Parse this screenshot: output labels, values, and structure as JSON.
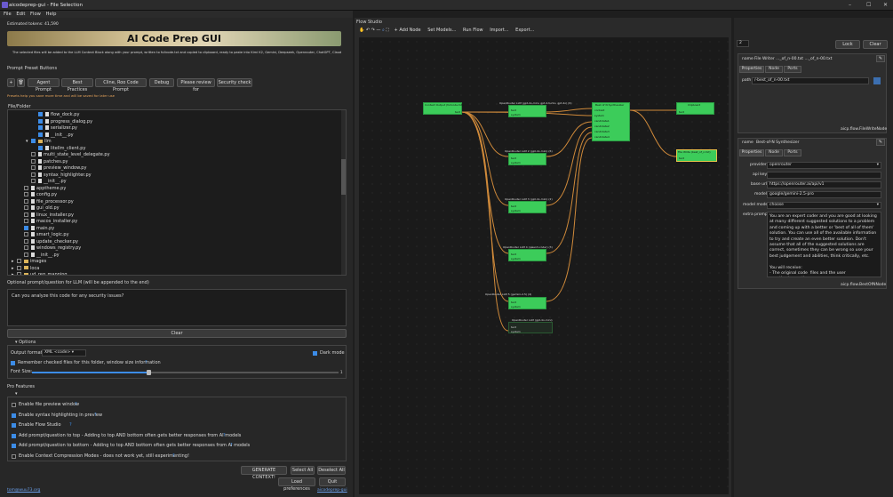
{
  "window": {
    "title": "aicodeprep-gui - File Selection"
  },
  "menu": [
    "File",
    "Edit",
    "Flow",
    "Help"
  ],
  "left": {
    "estimated_tokens": "Estimated tokens: 41,590",
    "banner_title": "AI Code Prep GUI",
    "info_text": "The selected files will be added to the LLM Context Block along with your prompt, written to fullcode.txt and copied to clipboard, ready to paste into Kimi K2, Gemini, Deepseek, Openrouter, ChatGPT, Claude",
    "preset_header": "Prompt Preset Buttons",
    "preset_buttons": [
      "Agent Prompt",
      "Best Practices",
      "Cline, Roo Code Prompt",
      "Debug",
      "Please review for",
      "Security check"
    ],
    "preset_hint": "Presets help you save more time and will be saved for later use",
    "tree_header": "File/Folder",
    "tree": [
      {
        "name": "flow_dock.py",
        "indent": 3,
        "type": "file",
        "checked": true
      },
      {
        "name": "progress_dialog.py",
        "indent": 3,
        "type": "file",
        "checked": true
      },
      {
        "name": "serializer.py",
        "indent": 3,
        "type": "file",
        "checked": true
      },
      {
        "name": "__init__.py",
        "indent": 3,
        "type": "file",
        "checked": true
      },
      {
        "name": "llm",
        "indent": 2,
        "type": "folder",
        "checked": true
      },
      {
        "name": "litellm_client.py",
        "indent": 3,
        "type": "file",
        "checked": true
      },
      {
        "name": "multi_state_level_delegate.py",
        "indent": 2,
        "type": "file",
        "checked": false
      },
      {
        "name": "patches.py",
        "indent": 2,
        "type": "file",
        "checked": false
      },
      {
        "name": "preview_window.py",
        "indent": 2,
        "type": "file",
        "checked": false
      },
      {
        "name": "syntax_highlighter.py",
        "indent": 2,
        "type": "file",
        "checked": false
      },
      {
        "name": "__init__.py",
        "indent": 2,
        "type": "file",
        "checked": false
      },
      {
        "name": "apptheme.py",
        "indent": 1,
        "type": "file",
        "checked": false
      },
      {
        "name": "config.py",
        "indent": 1,
        "type": "file",
        "checked": false
      },
      {
        "name": "file_processor.py",
        "indent": 1,
        "type": "file",
        "checked": false
      },
      {
        "name": "gui_old.py",
        "indent": 1,
        "type": "file",
        "checked": false
      },
      {
        "name": "linux_installer.py",
        "indent": 1,
        "type": "file",
        "checked": false
      },
      {
        "name": "macos_installer.py",
        "indent": 1,
        "type": "file",
        "checked": false
      },
      {
        "name": "main.py",
        "indent": 1,
        "type": "file",
        "checked": true
      },
      {
        "name": "smart_logic.py",
        "indent": 1,
        "type": "file",
        "checked": false
      },
      {
        "name": "update_checker.py",
        "indent": 1,
        "type": "file",
        "checked": false
      },
      {
        "name": "windows_registry.py",
        "indent": 1,
        "type": "file",
        "checked": false
      },
      {
        "name": "__init__.py",
        "indent": 1,
        "type": "file",
        "checked": false
      },
      {
        "name": "images",
        "indent": 0,
        "type": "folder",
        "checked": false
      },
      {
        "name": "loca",
        "indent": 0,
        "type": "folder",
        "checked": false
      },
      {
        "name": "ud_reg_mapping",
        "indent": 0,
        "type": "folder",
        "checked": false
      }
    ],
    "prompt_label": "Optional prompt/question for LLM (will be appended to the end)",
    "prompt_value": "Can you analyze this code for any security issues?",
    "clear_label": "Clear",
    "options_header": "Options",
    "output_format_label": "Output format:",
    "output_format_value": "XML <code>",
    "dark_mode_label": "Dark mode",
    "remember_label": "Remember checked files for this folder, window size information",
    "font_size_label": "Font Size:",
    "font_size_fraction": 0.38,
    "pro_header": "Pro Features",
    "pro_features": [
      {
        "label": "Enable file preview window",
        "checked": false
      },
      {
        "label": "Enable syntax highlighting in preview",
        "checked": true
      },
      {
        "label": "Enable Flow Studio",
        "checked": true
      },
      {
        "label": "Add prompt/question to top - Adding to top AND bottom often gets better responses from AI models",
        "checked": true
      },
      {
        "label": "Add prompt/question to bottom - Adding to top AND bottom often gets better responses from AI models",
        "checked": true
      },
      {
        "label": "Enable Context Compression Modes - does not work yet, still experimenting!",
        "checked": false
      }
    ],
    "buttons": {
      "generate": "GENERATE CONTEXT!",
      "select_all": "Select All",
      "deselect_all": "Deselect All",
      "load_prefs": "Load preferences",
      "quit": "Quit"
    },
    "footer_left": "tom@wuu73.org",
    "footer_right": "aicodeprep-gui"
  },
  "flow": {
    "title": "Flow Studio",
    "toolbar": [
      "Add Node",
      "Set Models...",
      "Run Flow",
      "Import...",
      "Export..."
    ],
    "nodes": [
      {
        "title": "Context Output (fullcode.txt)",
        "ports": [
          "text"
        ]
      },
      {
        "title": "OpenRouter LLM (gpt-4o-mini, gpt-4-turbo, gpt-4o) (9)",
        "ports": [
          "text",
          "system"
        ]
      },
      {
        "title": "OpenRouter LLM 2 (gpt-4o-mini) (6)",
        "ports": [
          "text",
          "system"
        ]
      },
      {
        "title": "OpenRouter LLM 3 (gpt-4o-mini) (2)",
        "ports": [
          "text",
          "system"
        ]
      },
      {
        "title": "OpenRouter LLM 4 (qwen3-coder) (3)",
        "ports": [
          "text",
          "system"
        ]
      },
      {
        "title": "OpenRouter LLM 5 (gemini-2.5) (4)",
        "ports": [
          "text",
          "system"
        ]
      },
      {
        "title": "Best of N Synthesizer",
        "ports": [
          "context",
          "system",
          "candidate1",
          "candidate2",
          "candidate3",
          "candidate4",
          "candidate5"
        ]
      },
      {
        "title": "Clipboard",
        "ports": [
          "text"
        ]
      },
      {
        "title": "File Write (best_of_n.txt)",
        "ports": [
          "text"
        ]
      },
      {
        "title": "OpenRouter LLM (gpt-4o-mini)",
        "ports": [
          "text",
          "system"
        ]
      }
    ]
  },
  "props": {
    "counter": "2",
    "lock_label": "Lock",
    "clear_label": "Clear",
    "node1": {
      "name_label": "name",
      "name_value": "File Writer ..._of_n-00.txt ..._of_n-00.txt",
      "tabs": [
        "Properties",
        "Node",
        "Ports"
      ],
      "path_label": "path",
      "path_value": "/-best_of_n-00.txt",
      "footer": "aicp.flow.FileWriteNode"
    },
    "node2": {
      "name_label": "name",
      "name_value": "Best-of-N Synthesizer",
      "tabs": [
        "Properties",
        "Node",
        "Ports"
      ],
      "fields": [
        {
          "label": "provider",
          "value": "openrouter"
        },
        {
          "label": "api key",
          "value": ""
        },
        {
          "label": "base url",
          "value": "https://openrouter.ai/api/v1"
        },
        {
          "label": "model",
          "value": "google/gemini-2.5-pro"
        },
        {
          "label": "model mode",
          "value": "choose"
        }
      ],
      "extra_prompt_label": "extra prompt",
      "extra_prompt_value": "You are an expert coder and you are good at looking at many different suggested solutions to a problem and coming up with a better or 'best of all of them' solution. You can use all of the available information to try and create an even better solution. Don't assume that all of the suggested solutions are correct, sometimes they can be wrong so use your best judgement and abilities, think critically, etc.\n\nYou will receive:\n- The original code  files and the user question/prompt).\n- N candidate answers from different AI models.",
      "footer": "aicp.flow.BestOfNNode"
    }
  },
  "colors": {
    "node_green": "#3ccc5a",
    "wire": "#d08a3a",
    "accent": "#3c8ce7"
  }
}
